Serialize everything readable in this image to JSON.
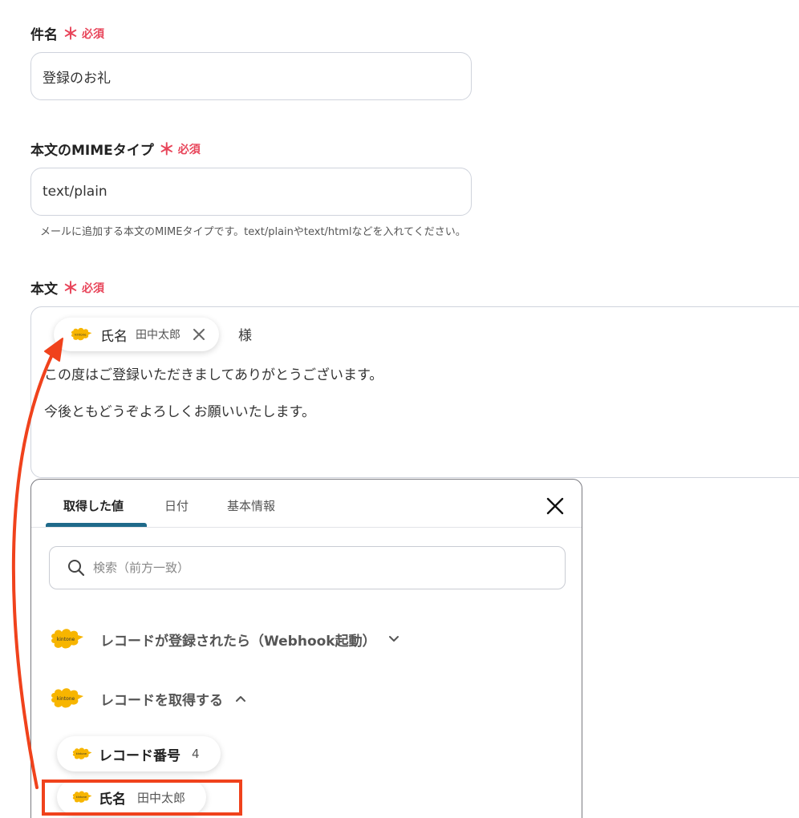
{
  "subject": {
    "label": "件名",
    "required_mark": "＊",
    "required_text": "必須",
    "value": "登録のお礼"
  },
  "mime": {
    "label": "本文のMIMEタイプ",
    "required_mark": "＊",
    "required_text": "必須",
    "value": "text/plain",
    "hint": "メールに追加する本文のMIMEタイプです。text/plainやtext/htmlなどを入れてください。"
  },
  "body": {
    "label": "本文",
    "required_mark": "＊",
    "required_text": "必須",
    "chip": {
      "name": "氏名",
      "value": "田中太郎",
      "icon": "kintone-icon"
    },
    "suffix": "様",
    "line1": "この度はご登録いただきましてありがとうございます。",
    "line2": "今後ともどうぞよろしくお願いいたします。"
  },
  "panel": {
    "tabs": [
      {
        "label": "取得した値"
      },
      {
        "label": "日付"
      },
      {
        "label": "基本情報"
      }
    ],
    "search_placeholder": "検索（前方一致）",
    "groups": [
      {
        "label": "レコードが登録されたら（Webhook起動）",
        "state": "collapsed"
      },
      {
        "label": "レコードを取得する",
        "state": "expanded"
      }
    ],
    "items": [
      {
        "name": "レコード番号",
        "value": "4"
      },
      {
        "name": "氏名",
        "value": "田中太郎"
      }
    ]
  },
  "colors": {
    "required": "#e8455a",
    "tab_underline": "#1f6a8a",
    "annotation": "#f0421c",
    "kintone": "#f7b500"
  }
}
